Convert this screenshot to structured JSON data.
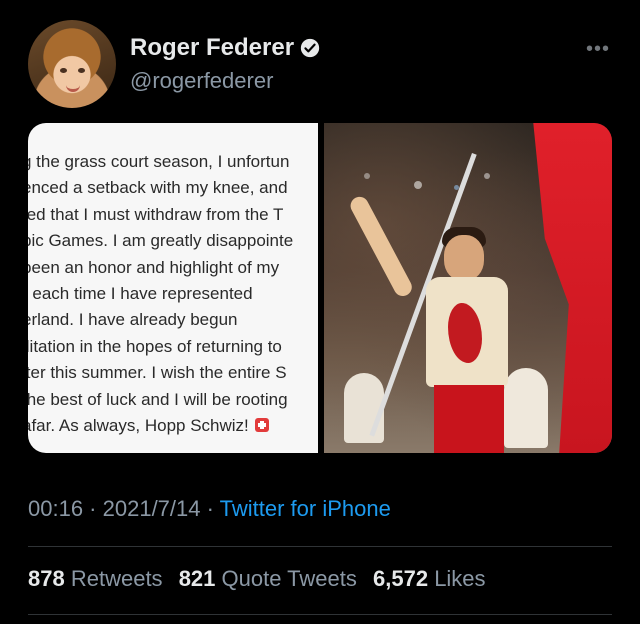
{
  "author": {
    "name": "Roger Federer",
    "handle": "@rogerfederer",
    "verified": true
  },
  "note_lines": [
    "g the grass court season, I unfortun",
    "enced a setback with my knee, and",
    "ted that I must withdraw from the T",
    "pic Games. I am greatly disappointe",
    "been an honor and highlight of my",
    "r each time I have represented",
    "erland. I have already begun",
    "ilitation in the hopes of returning to",
    "iter this summer. I wish the entire S",
    "the best of luck and I will be rooting",
    "afar. As always, Hopp Schwiz!"
  ],
  "meta": {
    "time": "00:16",
    "date": "2021/7/14",
    "source": "Twitter for iPhone"
  },
  "stats": {
    "retweets_count": "878",
    "retweets_label": "Retweets",
    "quotes_count": "821",
    "quotes_label": "Quote Tweets",
    "likes_count": "6,572",
    "likes_label": "Likes"
  },
  "icons": {
    "verified": "verified-badge-icon",
    "more": "more-options-icon",
    "swiss_flag": "swiss-flag-emoji"
  },
  "colors": {
    "background": "#000000",
    "link": "#1d9bf0",
    "secondary_text": "#8b98a5"
  }
}
